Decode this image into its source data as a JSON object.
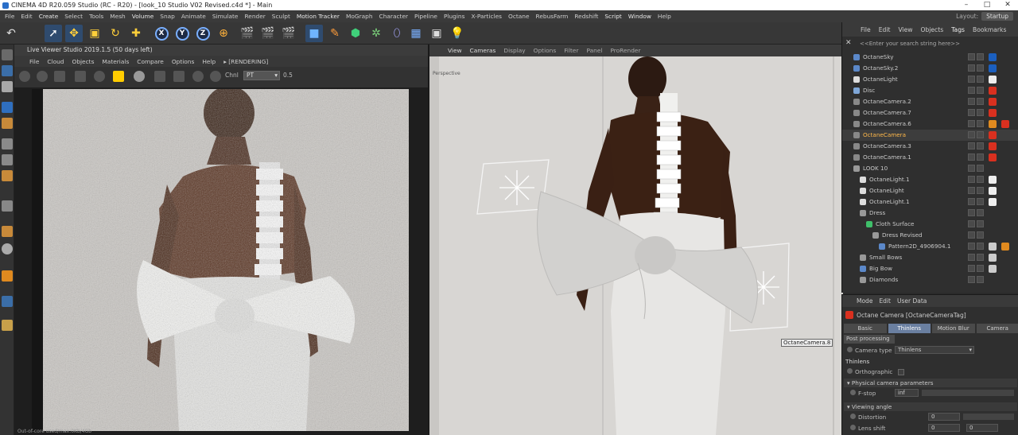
{
  "window": {
    "title": "CINEMA 4D R20.059 Studio (RC - R20) - [look_10 Studio V02 Revised.c4d *] - Main",
    "controls": [
      "–",
      "□",
      "✕"
    ]
  },
  "menu": [
    "File",
    "Edit",
    "Create",
    "Select",
    "Tools",
    "Mesh",
    "Volume",
    "Snap",
    "Animate",
    "Simulate",
    "Render",
    "Sculpt",
    "Motion Tracker",
    "MoGraph",
    "Character",
    "Pipeline",
    "Plugins",
    "X-Particles",
    "Octane",
    "RebusFarm",
    "Redshift",
    "Script",
    "Window",
    "Help"
  ],
  "layout": {
    "label": "Layout:",
    "value": "Startup"
  },
  "live_viewer": {
    "title": "Live Viewer Studio 2019.1.5 (50 days left)",
    "menu": [
      "File",
      "Cloud",
      "Objects",
      "Materials",
      "Compare",
      "Options",
      "Help",
      "▸ [RENDERING]"
    ],
    "channel_label": "Chnl",
    "channel_value": "PT",
    "exposure": "0.5",
    "status": "Out-of-core used/max:0Kb/4Gb"
  },
  "viewport": {
    "menu": [
      "View",
      "Cameras",
      "Display",
      "Options",
      "Filter",
      "Panel",
      "ProRender"
    ],
    "corner_label": "Perspective",
    "camera_label": "OctaneCamera.8"
  },
  "object_manager": {
    "tabs": [
      "File",
      "Edit",
      "View",
      "Objects",
      "Tags",
      "Bookmarks"
    ],
    "search_placeholder": "<<Enter your search string here>>",
    "rows": [
      {
        "name": "OctaneSky",
        "indent": 0,
        "icon": "#5b88c9",
        "tag": "#1b5fbf",
        "tag2": ""
      },
      {
        "name": "OctaneSky.2",
        "indent": 0,
        "icon": "#5b88c9",
        "tag": "#1b5fbf",
        "tag2": ""
      },
      {
        "name": "OctaneLight",
        "indent": 0,
        "icon": "#dddddd",
        "tag": "#eeeeee",
        "tag2": ""
      },
      {
        "name": "Disc",
        "indent": 0,
        "icon": "#7fa7d8",
        "tag": "#d9301f",
        "tag2": ""
      },
      {
        "name": "OctaneCamera.2",
        "indent": 0,
        "icon": "#888888",
        "tag": "#d9301f",
        "tag2": ""
      },
      {
        "name": "OctaneCamera.7",
        "indent": 0,
        "icon": "#888888",
        "tag": "#d9301f",
        "tag2": ""
      },
      {
        "name": "OctaneCamera.6",
        "indent": 0,
        "icon": "#888888",
        "tag": "#e08a1f",
        "tag2": "#d9301f"
      },
      {
        "name": "OctaneCamera",
        "indent": 0,
        "icon": "#888888",
        "tag": "#d9301f",
        "tag2": "",
        "selected": true
      },
      {
        "name": "OctaneCamera.3",
        "indent": 0,
        "icon": "#888888",
        "tag": "#d9301f",
        "tag2": ""
      },
      {
        "name": "OctaneCamera.1",
        "indent": 0,
        "icon": "#888888",
        "tag": "#d9301f",
        "tag2": ""
      },
      {
        "name": "LOOK 10",
        "indent": 0,
        "icon": "#999999",
        "tag": "",
        "tag2": ""
      },
      {
        "name": "OctaneLight.1",
        "indent": 1,
        "icon": "#dddddd",
        "tag": "#eeeeee",
        "tag2": ""
      },
      {
        "name": "OctaneLight",
        "indent": 1,
        "icon": "#dddddd",
        "tag": "#eeeeee",
        "tag2": ""
      },
      {
        "name": "OctaneLight.1",
        "indent": 1,
        "icon": "#dddddd",
        "tag": "#eeeeee",
        "tag2": ""
      },
      {
        "name": "Dress",
        "indent": 1,
        "icon": "#999999",
        "tag": "",
        "tag2": ""
      },
      {
        "name": "Cloth Surface",
        "indent": 2,
        "icon": "#3fbf6a",
        "tag": "",
        "tag2": ""
      },
      {
        "name": "Dress Revised",
        "indent": 3,
        "icon": "#999999",
        "tag": "",
        "tag2": ""
      },
      {
        "name": "Pattern2D_4906904.1",
        "indent": 4,
        "icon": "#5b88c9",
        "tag": "#cccccc",
        "tag2": "#e08a1f"
      },
      {
        "name": "Small Bows",
        "indent": 1,
        "icon": "#999999",
        "tag": "#cccccc",
        "tag2": ""
      },
      {
        "name": "Big Bow",
        "indent": 1,
        "icon": "#5b88c9",
        "tag": "#cccccc",
        "tag2": ""
      },
      {
        "name": "Diamonds",
        "indent": 1,
        "icon": "#999999",
        "tag": "",
        "tag2": ""
      }
    ]
  },
  "attribute_manager": {
    "menu": [
      "Mode",
      "Edit",
      "User Data"
    ],
    "title": "Octane Camera [OctaneCameraTag]",
    "tabs": [
      "Basic",
      "Thinlens",
      "Motion Blur",
      "Camera"
    ],
    "post_processing": "Post processing",
    "camera_type_label": "Camera type",
    "camera_type_value": "Thinlens",
    "thinlens_label": "Thinlens",
    "orthographic_label": "Orthographic",
    "physical_section": "Physical camera parameters",
    "fstop_label": "F-stop",
    "fstop_value": "inf",
    "viewing_section": "Viewing angle",
    "distortion_label": "Distortion",
    "distortion_value": "0",
    "lens_shift_label": "Lens shift",
    "lens_shift_value": "0"
  }
}
